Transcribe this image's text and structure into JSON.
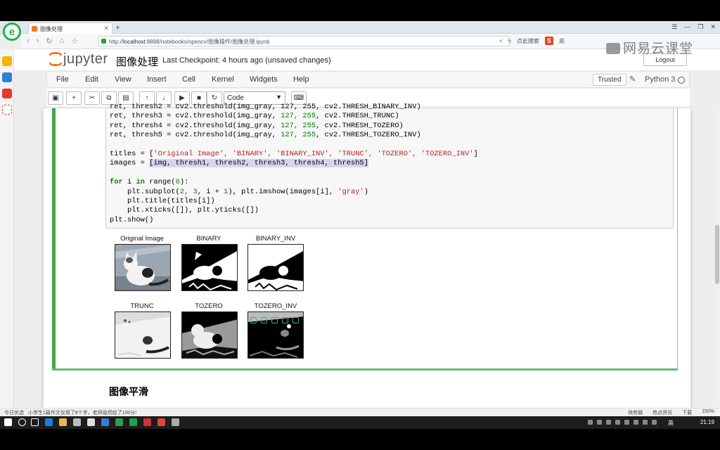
{
  "browser": {
    "tab_title": "图像处理",
    "url_host": "localhost",
    "url_rest": ":8888/notebooks/opencv/图像操作/图像处理.ipynb",
    "url_prefix": "http://",
    "nav_right_text": "点此搜索",
    "sogou_label": "英"
  },
  "watermark": "网易云课堂",
  "jupyter": {
    "logo_text": "jupyter",
    "notebook_title": "图像处理",
    "checkpoint": "Last Checkpoint: 4 hours ago (unsaved changes)",
    "logout_label": "Logout",
    "menu": [
      "File",
      "Edit",
      "View",
      "Insert",
      "Cell",
      "Kernel",
      "Widgets",
      "Help"
    ],
    "trusted_label": "Trusted",
    "kernel_name": "Python 3",
    "cell_type": "Code"
  },
  "code": {
    "line0": "ret, thresh2 = cv2.threshold(img_gray, 127, 255, cv2.THRESH_BINARY_INV)",
    "line1_a": "ret, thresh3 = cv2.threshold(img_gray, ",
    "line1_n": "127, 255",
    "line1_b": ", cv2.THRESH_TRUNC)",
    "line2_a": "ret, thresh4 = cv2.threshold(img_gray, ",
    "line2_n": "127, 255",
    "line2_b": ", cv2.THRESH_TOZERO)",
    "line3_a": "ret, thresh5 = cv2.threshold(img_gray, ",
    "line3_n": "127, 255",
    "line3_b": ", cv2.THRESH_TOZERO_INV)",
    "titles_a": "titles = [",
    "titles_s": "'Original Image', 'BINARY', 'BINARY_INV', 'TRUNC', 'TOZERO', 'TOZERO_INV'",
    "titles_b": "]",
    "images_a": "images = ",
    "images_sel": "[img, thresh1, thresh2, thresh3, thresh4, thresh5]",
    "for_k": "for",
    "for_mid": " i ",
    "for_in": "in",
    "for_rest_a": " range(",
    "for_rest_n": "6",
    "for_rest_b": "):",
    "sub_a": "    plt.subplot(",
    "sub_n": "2, 3",
    "sub_b": ", i + ",
    "sub_n2": "1",
    "sub_c": "), plt.imshow(images[i], ",
    "sub_s": "'gray'",
    "sub_d": ")",
    "title_line": "    plt.title(titles[i])",
    "ticks_line": "    plt.xticks([]), plt.yticks([])",
    "show_line": "plt.show()"
  },
  "output": {
    "titles": [
      "Original Image",
      "BINARY",
      "BINARY_INV",
      "TRUNC",
      "TOZERO",
      "TOZERO_INV"
    ]
  },
  "next_heading": "图像平滑",
  "statusbar": {
    "left": "今日优选",
    "news": "小学生1篇作文仅用了8个字，老师竟然给了100分!",
    "right": [
      "快剪辑",
      "热点资讯",
      "下载",
      "150%"
    ]
  },
  "taskbar": {
    "clock": "21:19",
    "ime": "英"
  }
}
